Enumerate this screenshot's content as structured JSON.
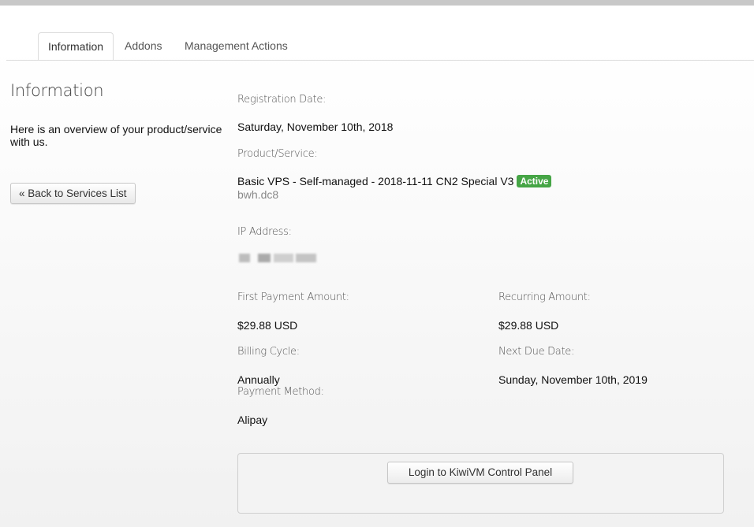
{
  "tabs": [
    {
      "label": "Information",
      "active": true
    },
    {
      "label": "Addons",
      "active": false
    },
    {
      "label": "Management Actions",
      "active": false
    }
  ],
  "sidebar": {
    "title": "Information",
    "overview": "Here is an overview of your product/service with us.",
    "back_button": "« Back to Services List"
  },
  "details": {
    "registration_date": {
      "label": "Registration Date:",
      "value": "Saturday, November 10th, 2018"
    },
    "product": {
      "label": "Product/Service:",
      "name": "Basic VPS - Self-managed - 2018-11-11 CN2 Special V3",
      "status": "Active",
      "hostname": "bwh.dc8"
    },
    "ip_address": {
      "label": "IP Address:"
    },
    "first_payment": {
      "label": "First Payment Amount:",
      "value": "$29.88 USD"
    },
    "recurring_amount": {
      "label": "Recurring Amount:",
      "value": "$29.88 USD"
    },
    "billing_cycle": {
      "label": "Billing Cycle:",
      "value": "Annually"
    },
    "next_due_date": {
      "label": "Next Due Date:",
      "value": "Sunday, November 10th, 2019"
    },
    "payment_method": {
      "label": "Payment Method:",
      "value": "Alipay"
    }
  },
  "panel": {
    "login_button": "Login to KiwiVM Control Panel"
  },
  "colors": {
    "status_active": "#46a546"
  }
}
